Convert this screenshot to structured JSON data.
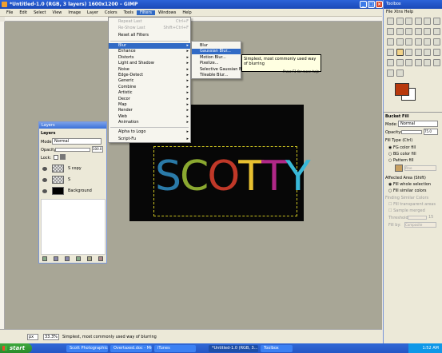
{
  "window": {
    "title": "*Untitled-1.0 (RGB, 3 layers) 1600x1200 – GIMP"
  },
  "menubar": [
    "File",
    "Edit",
    "Select",
    "View",
    "Image",
    "Layer",
    "Colors",
    "Tools",
    "Filters",
    "Windows",
    "Help"
  ],
  "filters_menu": {
    "top_items": [
      {
        "label": "Repeat Last",
        "shortcut": "Ctrl+F",
        "disabled": true
      },
      {
        "label": "Re-Show Last",
        "shortcut": "Shift+Ctrl+F",
        "disabled": true
      },
      {
        "label": "Reset all Filters",
        "disabled": false
      }
    ],
    "items": [
      "Blur",
      "Enhance",
      "Distorts",
      "Light and Shadow",
      "Noise",
      "Edge-Detect",
      "Generic",
      "Combine",
      "Artistic",
      "Decor",
      "Map",
      "Render",
      "Web",
      "Animation"
    ],
    "bottom_items": [
      "Alpha to Logo",
      "Script-Fu"
    ]
  },
  "blur_submenu": [
    "Blur",
    "Gaussian Blur...",
    "Motion Blur...",
    "Pixelize...",
    "Selective Gaussian Blur...",
    "Tileable Blur..."
  ],
  "tooltip": {
    "text": "Simplest, most commonly used way of blurring",
    "help": "Press F1 for more help"
  },
  "canvas": {
    "logo_text": [
      "S",
      "C",
      "O",
      "T",
      "T",
      "Y"
    ],
    "logo_colors": [
      "#2a7aa8",
      "#8aa830",
      "#c03828",
      "#e8c030",
      "#b02888",
      "#38b8d8"
    ]
  },
  "layers_dock": {
    "title": "Layers",
    "mode_label": "Mode:",
    "mode_value": "Normal",
    "opacity_label": "Opacity:",
    "opacity_value": "100.0",
    "lock_label": "Lock:",
    "layers": [
      "S copy",
      "S",
      "Background"
    ]
  },
  "toolbox": {
    "title": "Toolbox",
    "bucket_fill": {
      "title": "Bucket Fill",
      "mode_label": "Mode:",
      "mode_value": "Normal",
      "opacity_label": "Opacity:",
      "opacity_value": "75.0",
      "fill_type_label": "Fill Type (Ctrl)",
      "fill_options": [
        "FG color fill",
        "BG color fill",
        "Pattern fill"
      ],
      "pattern_name": "Pine",
      "affected_label": "Affected Area (Shift)",
      "affected_options": [
        "Fill whole selection",
        "Fill similar colors"
      ],
      "finding_label": "Finding Similar Colors",
      "finding_options": [
        "Fill transparent areas",
        "Sample merged"
      ],
      "threshold_label": "Threshold:",
      "threshold_value": "15",
      "fill_by_label": "Fill by:",
      "fill_by_value": "Composite"
    },
    "fg_color": "#b8380c",
    "bg_color": "#ffffff"
  },
  "status": {
    "unit": "px",
    "zoom": "33.3%",
    "message": "Simplest, most commonly used way of blurring"
  },
  "taskbar": {
    "start": "start",
    "tasks": [
      "Scott Photographics |...",
      "Overtaxed.doc - Micr...",
      "iTunes",
      "*Untitled-1.0 (RGB, 3...",
      "Toolbox"
    ],
    "time": "1:52 AM"
  }
}
